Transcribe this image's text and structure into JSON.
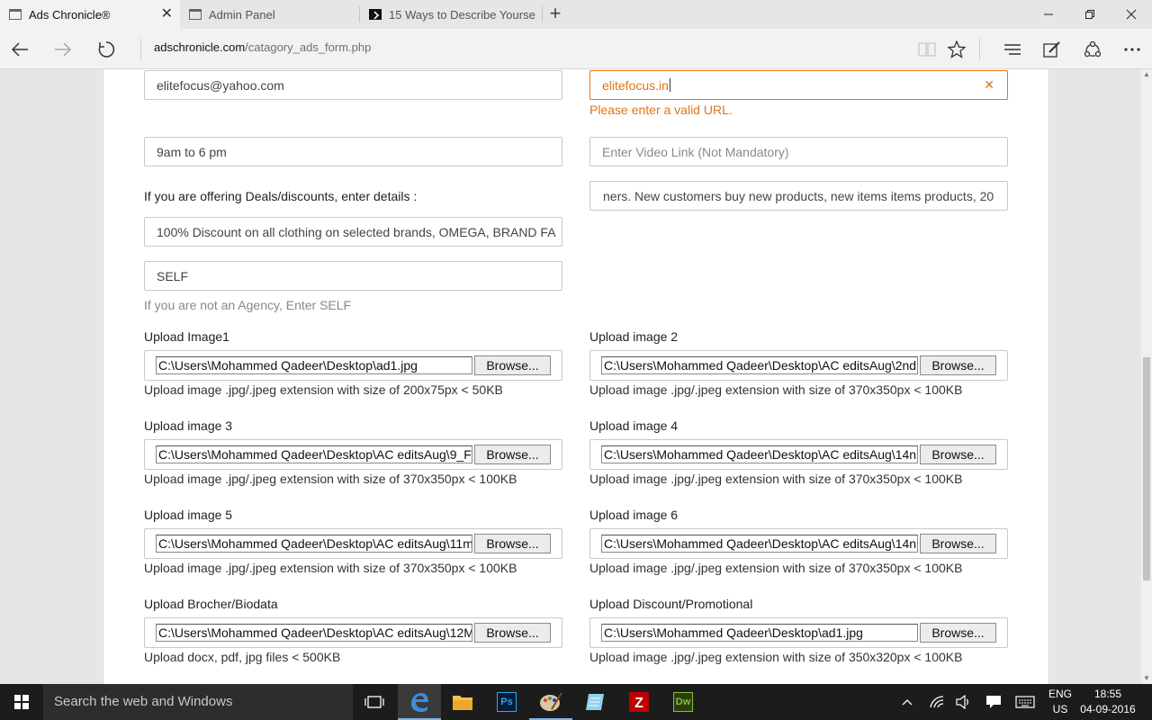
{
  "tabs": [
    {
      "title": "Ads Chronicle®",
      "icon": "page-icon",
      "active": true
    },
    {
      "title": "Admin Panel",
      "icon": "page-icon",
      "active": false
    },
    {
      "title": "15 Ways to Describe Yourse",
      "icon": "medium-icon",
      "active": false
    }
  ],
  "nav": {
    "address_host": "adschronicle.com",
    "address_path": "/catagory_ads_form.php"
  },
  "form": {
    "email_value": "elitefocus@yahoo.com",
    "website_value": "elitefocus.in",
    "website_error": "Please enter a valid URL.",
    "timing_value": "9am to 6 pm",
    "video_placeholder": "Enter Video Link (Not Mandatory)",
    "deals_label": "If you are offering Deals/discounts, enter details :",
    "description_value": "ners. New customers buy new products, new items items products, 20",
    "deals_value": "100% Discount on all clothing on selected brands, OMEGA, BRAND FA",
    "agency_value": "SELF",
    "agency_help": "If you are not an Agency, Enter SELF",
    "browse_label": "Browse...",
    "uploads": [
      {
        "label": "Upload Image1",
        "path": "C:\\Users\\Mohammed Qadeer\\Desktop\\ad1.jpg",
        "hint": "Upload image .jpg/.jpeg extension with size of 200x75px < 50KB"
      },
      {
        "label": "Upload image 2",
        "path": "C:\\Users\\Mohammed Qadeer\\Desktop\\AC editsAug\\2nd",
        "hint": "Upload image .jpg/.jpeg extension with size of 370x350px < 100KB"
      },
      {
        "label": "Upload image 3",
        "path": "C:\\Users\\Mohammed Qadeer\\Desktop\\AC editsAug\\9_F",
        "hint": "Upload image .jpg/.jpeg extension with size of 370x350px < 100KB"
      },
      {
        "label": "Upload image 4",
        "path": "C:\\Users\\Mohammed Qadeer\\Desktop\\AC editsAug\\14n",
        "hint": "Upload image .jpg/.jpeg extension with size of 370x350px < 100KB"
      },
      {
        "label": "Upload image 5",
        "path": "C:\\Users\\Mohammed Qadeer\\Desktop\\AC editsAug\\11m",
        "hint": "Upload image .jpg/.jpeg extension with size of 370x350px < 100KB"
      },
      {
        "label": "Upload image 6",
        "path": "C:\\Users\\Mohammed Qadeer\\Desktop\\AC editsAug\\14n",
        "hint": "Upload image .jpg/.jpeg extension with size of 370x350px < 100KB"
      },
      {
        "label": "Upload Brocher/Biodata",
        "path": "C:\\Users\\Mohammed Qadeer\\Desktop\\AC editsAug\\12M",
        "hint": "Upload docx, pdf, jpg files < 500KB"
      },
      {
        "label": "Upload Discount/Promotional",
        "path": "C:\\Users\\Mohammed Qadeer\\Desktop\\ad1.jpg",
        "hint": "Upload image .jpg/.jpeg extension with size of 350x320px < 100KB"
      }
    ]
  },
  "taskbar": {
    "search_placeholder": "Search the web and Windows",
    "lang_line1": "ENG",
    "lang_line2": "US",
    "time": "18:55",
    "date": "04-09-2016",
    "apps": [
      "task-view",
      "edge",
      "file-explorer",
      "photoshop",
      "paint",
      "notepad",
      "filezilla",
      "dreamweaver"
    ],
    "ps_label": "Ps",
    "dw_label": "Dw"
  },
  "colors": {
    "error": "#e07418",
    "taskbar": "#1c1c1c",
    "tab_active": "#f2f2f2"
  }
}
